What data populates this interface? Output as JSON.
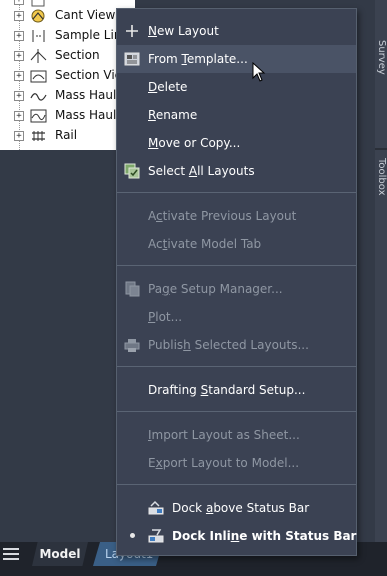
{
  "tree": {
    "items": [
      {
        "label": "",
        "icon": "partial-icon"
      },
      {
        "label": "Cant View",
        "icon": "cant-view-icon"
      },
      {
        "label": "Sample Lines",
        "icon": "sample-line-icon"
      },
      {
        "label": "Section",
        "icon": "section-icon"
      },
      {
        "label": "Section Views",
        "icon": "section-view-icon"
      },
      {
        "label": "Mass Haul Line",
        "icon": "mass-haul-line-icon"
      },
      {
        "label": "Mass Haul View",
        "icon": "mass-haul-view-icon"
      },
      {
        "label": "Rail",
        "icon": "rail-icon"
      }
    ],
    "expander_symbol": "+"
  },
  "right_strip": {
    "tab_top": "Survey",
    "tab_bottom": "Toolbox"
  },
  "statusbar": {
    "model_tab": "Model",
    "layout_tab": "Layout1"
  },
  "menu": {
    "items": [
      {
        "pre": "",
        "key": "N",
        "post": "ew Layout",
        "enabled": true,
        "icon": "plus-icon"
      },
      {
        "pre": "From ",
        "key": "T",
        "post": "emplate...",
        "enabled": true,
        "icon": "template-icon",
        "hover": true
      },
      {
        "pre": "",
        "key": "D",
        "post": "elete",
        "enabled": true
      },
      {
        "pre": "",
        "key": "R",
        "post": "ename",
        "enabled": true
      },
      {
        "pre": "",
        "key": "M",
        "post": "ove or Copy...",
        "enabled": true
      },
      {
        "pre": "Select ",
        "key": "A",
        "post": "ll Layouts",
        "enabled": true,
        "icon": "select-layouts-icon"
      },
      {
        "pre": "A",
        "key": "c",
        "post": "tivate Previous Layout",
        "enabled": false
      },
      {
        "pre": "Ac",
        "key": "t",
        "post": "ivate Model Tab",
        "enabled": false
      },
      {
        "pre": "Pa",
        "key": "g",
        "post": "e Setup Manager...",
        "enabled": false,
        "icon": "page-setup-icon"
      },
      {
        "pre": "",
        "key": "P",
        "post": "lot...",
        "enabled": false
      },
      {
        "pre": "Publis",
        "key": "h",
        "post": " Selected Layouts...",
        "enabled": false,
        "icon": "publish-icon"
      },
      {
        "pre": "Drafting ",
        "key": "S",
        "post": "tandard Setup...",
        "enabled": true
      },
      {
        "pre": "",
        "key": "I",
        "post": "mport Layout as Sheet...",
        "enabled": false
      },
      {
        "pre": "E",
        "key": "x",
        "post": "port Layout to Model...",
        "enabled": false
      },
      {
        "pre": "Dock ",
        "key": "a",
        "post": "bove Status Bar",
        "enabled": true,
        "icon": "dock-above-icon"
      },
      {
        "pre": "Dock Inli",
        "key": "n",
        "post": "e with Status Bar",
        "enabled": true,
        "icon": "dock-inline-icon",
        "checked": true
      }
    ]
  },
  "colors": {
    "menu_bg": "#3b4253",
    "menu_hover": "#4a5366",
    "menu_disabled_text": "#8f97a3",
    "layout_tab_accent": "#3a5f86"
  }
}
